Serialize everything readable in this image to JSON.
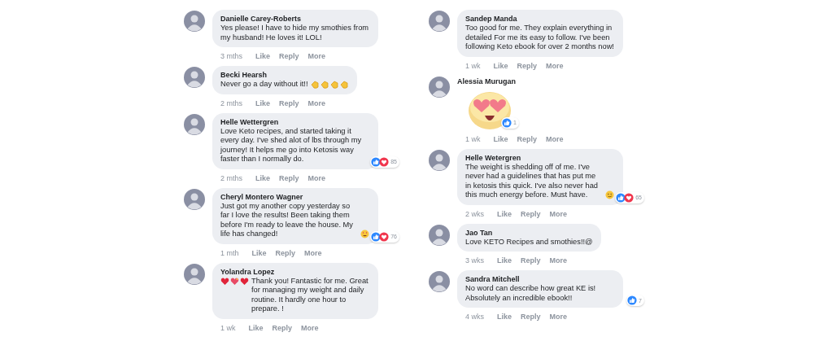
{
  "columns": [
    {
      "comments": [
        {
          "author": "Danielle Carey-Roberts",
          "text": "Yes please! I have to hide my smothies from my husband! He loves it! LOL!",
          "time": "3 mths",
          "actions": [
            "Like",
            "Reply",
            "More"
          ]
        },
        {
          "author": "Becki Hearsh",
          "text": "Never go a day without it!!",
          "emojis_after": [
            {
              "kind": "clap"
            },
            {
              "kind": "clap"
            },
            {
              "kind": "clap"
            },
            {
              "kind": "clap"
            }
          ],
          "time": "2 mths",
          "actions": [
            "Like",
            "Reply",
            "More"
          ]
        },
        {
          "author": "Helle Wettergren",
          "text": "Love Keto recipes, and started taking it every day. I've shed alot of lbs through my journey! It helps me go into Ketosis way faster than I normally do.",
          "reactions": {
            "items": [
              {
                "kind": "like"
              },
              {
                "kind": "love"
              }
            ],
            "count": "85"
          },
          "time": "2 mths",
          "actions": [
            "Like",
            "Reply",
            "More"
          ]
        },
        {
          "author": "Cheryl Montero Wagner",
          "text": "Just got my another copy yesterday so far I love the results! Been taking them before I'm ready to leave the house. My life has changed!",
          "emojis_after": [
            {
              "kind": "star-eyes"
            }
          ],
          "reactions": {
            "items": [
              {
                "kind": "like"
              },
              {
                "kind": "love"
              }
            ],
            "count": "76"
          },
          "time": "1 mth",
          "actions": [
            "Like",
            "Reply",
            "More"
          ]
        },
        {
          "author": "Yolandra Lopez",
          "emojis_before": [
            {
              "kind": "heart"
            },
            {
              "kind": "sparkle-heart"
            },
            {
              "kind": "heart"
            }
          ],
          "text": "Thank you! Fantastic for me. Great for managing my weight and daily routine. It hardly one hour to prepare. !",
          "time": "1 wk",
          "actions": [
            "Like",
            "Reply",
            "More"
          ]
        }
      ]
    },
    {
      "comments": [
        {
          "author": "Sandep Manda",
          "text": "Too good for me. They explain everything in detailed For me its easy to follow. I've been following Keto ebook for over 2 months now!",
          "time": "1 wk",
          "actions": [
            "Like",
            "Reply",
            "More"
          ]
        },
        {
          "author": "Alessia Murugan",
          "sticker": {
            "kind": "heart-eyes"
          },
          "reactions": {
            "items": [
              {
                "kind": "like"
              }
            ],
            "count": "1"
          },
          "time": "1 wk",
          "actions": [
            "Like",
            "Reply",
            "More"
          ]
        },
        {
          "author": "Helle Wetergren",
          "text": "The weight is shedding off of me. I've never had a guidelines that has put me in ketosis this quick. I've also never had this much energy before. Must have.",
          "emojis_after": [
            {
              "kind": "smirk"
            }
          ],
          "reactions": {
            "items": [
              {
                "kind": "like"
              },
              {
                "kind": "love"
              }
            ],
            "count": "65"
          },
          "time": "2 wks",
          "actions": [
            "Like",
            "Reply",
            "More"
          ]
        },
        {
          "author": "Jao Tan",
          "text": "Love KETO Recipes and smothies!!@",
          "time": "3 wks",
          "actions": [
            "Like",
            "Reply",
            "More"
          ]
        },
        {
          "author": "Sandra Mitchell",
          "text": "No word can describe how great KE is! Absolutely an incredible ebook!!",
          "reactions": {
            "items": [
              {
                "kind": "like"
              }
            ],
            "count": "7"
          },
          "time": "4 wks",
          "actions": [
            "Like",
            "Reply",
            "More"
          ]
        }
      ]
    }
  ]
}
